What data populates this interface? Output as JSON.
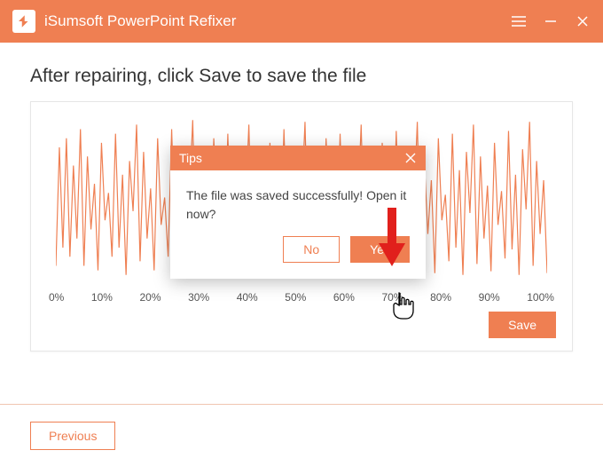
{
  "titlebar": {
    "app_name": "iSumsoft PowerPoint Refixer"
  },
  "main": {
    "heading": "After repairing, click Save to save the file",
    "save_label": "Save",
    "axis_ticks": [
      "0%",
      "10%",
      "20%",
      "30%",
      "40%",
      "50%",
      "60%",
      "70%",
      "80%",
      "90%",
      "100%"
    ]
  },
  "dialog": {
    "title": "Tips",
    "message": "The file was saved successfully! Open it now?",
    "no_label": "No",
    "yes_label": "Yes"
  },
  "footer": {
    "previous_label": "Previous"
  },
  "colors": {
    "accent": "#ef7f52",
    "arrow": "#e1201c"
  }
}
